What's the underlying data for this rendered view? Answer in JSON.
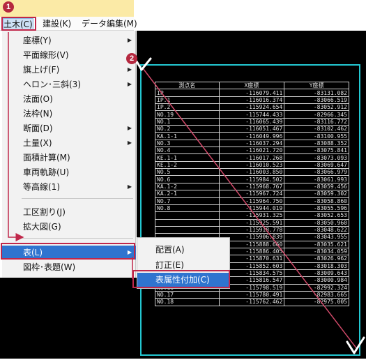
{
  "menubar": {
    "items": [
      {
        "label": "土木(C)",
        "active": true
      },
      {
        "label": "建設(K)",
        "active": false
      },
      {
        "label": "データ編集(M)",
        "active": false
      }
    ]
  },
  "dropdown": {
    "items": [
      {
        "label": "座標(Y)",
        "submenu": true
      },
      {
        "label": "平面線形(V)",
        "submenu": false
      },
      {
        "label": "旗上げ(F)",
        "submenu": true
      },
      {
        "label": "ヘロン･三斜(3)",
        "submenu": true
      },
      {
        "label": "法面(O)",
        "submenu": false
      },
      {
        "label": "法枠(N)",
        "submenu": false
      },
      {
        "label": "断面(D)",
        "submenu": true
      },
      {
        "label": "土量(X)",
        "submenu": true
      },
      {
        "label": "面積計算(M)",
        "submenu": false
      },
      {
        "label": "車両軌跡(U)",
        "submenu": false
      },
      {
        "label": "等高線(1)",
        "submenu": true
      },
      {
        "label": "工区割り(J)",
        "submenu": false
      },
      {
        "label": "拡大図(G)",
        "submenu": false
      },
      {
        "label": "表(L)",
        "submenu": true,
        "selected": true
      },
      {
        "label": "図枠･表題(W)",
        "submenu": false
      }
    ]
  },
  "submenu": {
    "items": [
      {
        "label": "配置(A)"
      },
      {
        "label": "訂正(E)"
      },
      {
        "label": "表属性付加(C)",
        "highlighted": true
      }
    ]
  },
  "table": {
    "headers": [
      "測点名",
      "X座標",
      "Y座標"
    ],
    "rows": [
      [
        "IP",
        "-116079.411",
        "-83131.082"
      ],
      [
        "IP.1",
        "-116016.374",
        "-83066.519"
      ],
      [
        "IP.2",
        "-115924.654",
        "-83052.912"
      ],
      [
        "NO.19",
        "-115744.433",
        "-82966.345"
      ],
      [
        "NO.1",
        "-116065.439",
        "-83116.772"
      ],
      [
        "NO.2",
        "-116051.467",
        "-83102.462"
      ],
      [
        "KA.1-1",
        "-116049.996",
        "-83100.955"
      ],
      [
        "NO.3",
        "-116037.294",
        "-83088.352"
      ],
      [
        "NO.4",
        "-116021.720",
        "-83075.841"
      ],
      [
        "KE.1-1",
        "-116017.268",
        "-83073.093"
      ],
      [
        "KE.1-2",
        "-116010.523",
        "-83069.647"
      ],
      [
        "NO.5",
        "-116003.850",
        "-83066.979"
      ],
      [
        "NO.6",
        "-115984.502",
        "-83061.993"
      ],
      [
        "KA.1-2",
        "-115968.767",
        "-83059.456"
      ],
      [
        "KA.2-1",
        "-115967.724",
        "-83059.302"
      ],
      [
        "NO.7",
        "-115964.750",
        "-83058.860"
      ],
      [
        "NO.8",
        "-115944.019",
        "-83055.596"
      ],
      [
        "",
        "-115931.325",
        "-83052.653"
      ],
      [
        "",
        "-115925.591",
        "-83050.960"
      ],
      [
        "",
        "-115918.778",
        "-83048.622"
      ],
      [
        "",
        "-115906.839",
        "-83043.955"
      ],
      [
        "",
        "-115888.660",
        "-83035.621"
      ],
      [
        "",
        "-115886.405",
        "-83034.059"
      ],
      [
        "NO.12",
        "-115870.631",
        "-83026.962"
      ],
      [
        "NO.13",
        "-115852.603",
        "-83018.303"
      ],
      [
        "NO.14",
        "-115834.575",
        "-83009.643"
      ],
      [
        "NO.15",
        "-115816.547",
        "-83000.984"
      ],
      [
        "NO.16",
        "-115798.519",
        "-82992.324"
      ],
      [
        "NO.17",
        "-115780.491",
        "-82983.665"
      ],
      [
        "NO.18",
        "-115762.462",
        "-82975.005"
      ]
    ]
  },
  "annotations": {
    "step1": "1",
    "step2": "2",
    "color": "#c0274a",
    "selection_color": "#23c7d1"
  }
}
